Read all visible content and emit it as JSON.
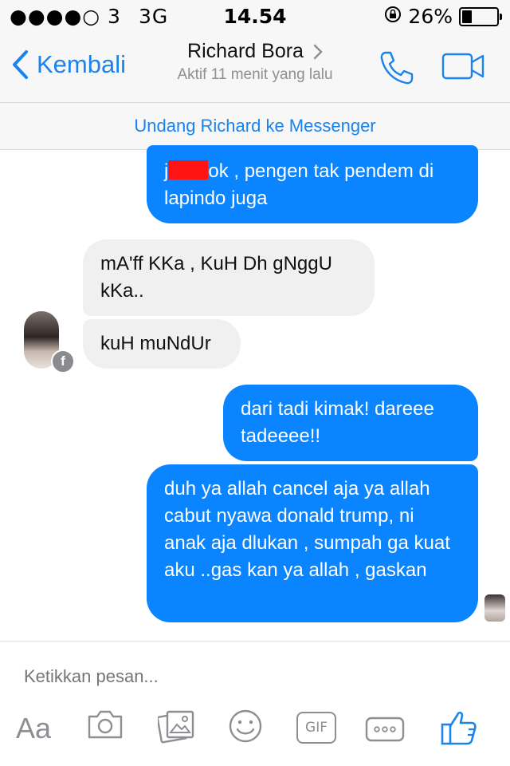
{
  "status_bar": {
    "signal": "●●●●○ 3",
    "network": "3G",
    "time": "14.54",
    "battery_percent": "26%",
    "battery_level": 0.26
  },
  "nav": {
    "back_label": "Kembali",
    "contact_name": "Richard Bora",
    "contact_status": "Aktif 11 menit yang lalu"
  },
  "invite": {
    "label": "Undang Richard ke Messenger"
  },
  "messages": [
    {
      "from": "me",
      "text_before_redact": "j",
      "text_after_redact": "ok , pengen tak pendem di lapindo juga"
    },
    {
      "from": "them",
      "text": "mA'ff KKa , KuH Dh gNggU kKa.."
    },
    {
      "from": "them",
      "text": "kuH muNdUr"
    },
    {
      "from": "me",
      "text": "dari tadi kimak! dareee tadeeee!!"
    },
    {
      "from": "me",
      "text": "duh ya allah cancel aja ya allah cabut nyawa donald trump, ni anak aja dlukan , sumpah ga kuat aku ..gas kan ya allah , gaskan"
    }
  ],
  "composer": {
    "placeholder": "Ketikkan pesan...",
    "aa_label": "Aa",
    "gif_label": "GIF"
  },
  "colors": {
    "accent": "#1a83ec",
    "outgoing_bubble": "#0a84ff",
    "incoming_bubble": "#f0f0f0",
    "redaction": "#ff1313"
  },
  "icons": [
    "chevron-left-icon",
    "chevron-right-icon",
    "phone-icon",
    "video-camera-icon",
    "facebook-badge-icon",
    "camera-icon",
    "photo-gallery-icon",
    "smiley-icon",
    "gif-icon",
    "more-icon",
    "thumbs-up-icon"
  ]
}
